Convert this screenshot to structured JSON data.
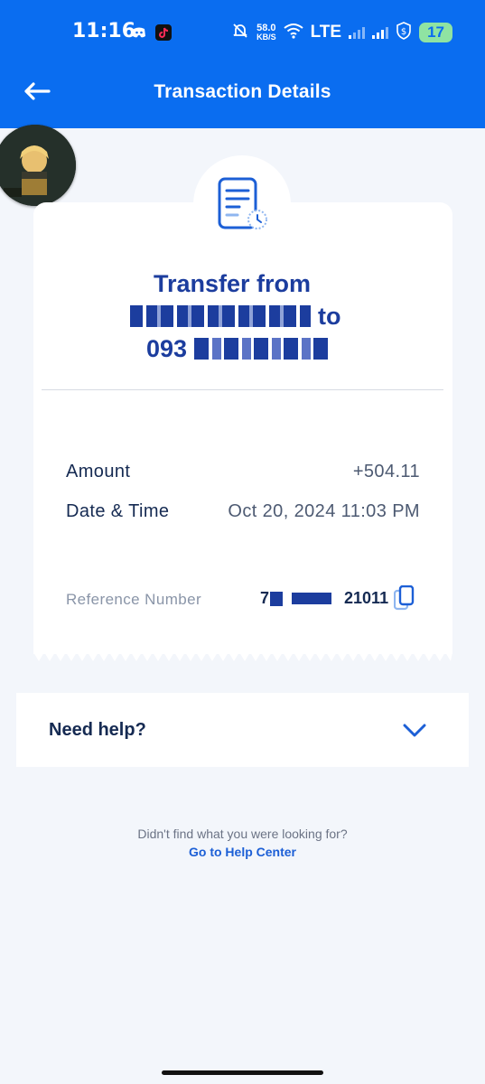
{
  "status_bar": {
    "time": "11:16",
    "net_speed_value": "58.0",
    "net_speed_unit": "KB/S",
    "network": "LTE",
    "battery": "17"
  },
  "header": {
    "title": "Transaction Details"
  },
  "transaction": {
    "title_line1": "Transfer from",
    "title_line2_suffix": "to",
    "title_line3_prefix": "093",
    "amount_label": "Amount",
    "amount_value": "+504.11",
    "datetime_label": "Date & Time",
    "datetime_value": "Oct 20, 2024 11:03 PM",
    "reference_label": "Reference Number",
    "reference_prefix": "7",
    "reference_suffix": "21011"
  },
  "help": {
    "label": "Need help?",
    "question": "Didn't find what you were looking for?",
    "link": "Go to Help Center"
  },
  "colors": {
    "brand_blue": "#0a6df0",
    "title_blue": "#1c3d9e",
    "background": "#f3f6fb"
  },
  "icons": [
    "back-arrow-icon",
    "document-clock-icon",
    "copy-icon",
    "chevron-down-icon"
  ]
}
